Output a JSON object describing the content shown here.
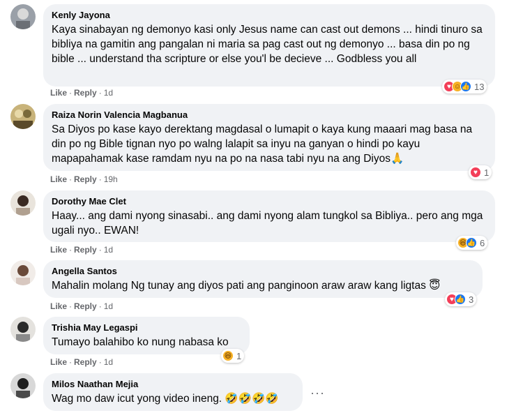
{
  "comments": [
    {
      "author": "Kenly Jayona",
      "text": "Kaya sinabayan ng demonyo kasi only Jesus name can cast out demons ... hindi tinuro sa bibliya na gamitin ang pangalan ni maria sa pag cast out ng demonyo ... basa din po ng bible ... understand tha scripture or else you'l be decieve ... Godbless you all",
      "like": "Like",
      "reply": "Reply",
      "time": "1d",
      "reaction_count": "13",
      "reactions": [
        "heart-icon",
        "care-icon",
        "like-icon"
      ]
    },
    {
      "author": "Raiza Norin Valencia Magbanua",
      "text": "Sa Diyos po kase kayo derektang magdasal o lumapit o kaya kung maaari mag basa na din po ng Bible tignan nyo po walng lalapit sa inyu na ganyan o hindi po kayu mapapahamak kase ramdam nyu na po na nasa tabi nyu na ang Diyos🙏",
      "like": "Like",
      "reply": "Reply",
      "time": "19h",
      "reaction_count": "1",
      "reactions": [
        "heart-icon"
      ]
    },
    {
      "author": "Dorothy Mae Clet",
      "text": "Haay... ang dami nyong sinasabi.. ang dami nyong alam tungkol sa Bibliya.. pero ang mga ugali nyo.. EWAN!",
      "like": "Like",
      "reply": "Reply",
      "time": "1d",
      "reaction_count": "6",
      "reactions": [
        "haha-icon",
        "like-icon"
      ]
    },
    {
      "author": "Angella Santos",
      "text": "Mahalin molang Ng tunay ang diyos pati ang panginoon araw araw kang ligtas 😇",
      "like": "Like",
      "reply": "Reply",
      "time": "1d",
      "reaction_count": "3",
      "reactions": [
        "heart-icon",
        "like-icon"
      ]
    },
    {
      "author": "Trishia May Legaspi",
      "text": "Tumayo balahibo ko nung nabasa ko",
      "like": "Like",
      "reply": "Reply",
      "time": "1d",
      "reaction_count": "1",
      "reactions": [
        "haha-icon"
      ]
    },
    {
      "author": "Milos Naathan Mejia",
      "text": "Wag mo daw icut yong video ineng. 🤣🤣🤣🤣",
      "more": "···"
    }
  ],
  "colors": {
    "bubble": "#f0f2f5",
    "meta": "#65676b",
    "heart": "#f33e58",
    "like": "#1877f2",
    "haha": "#f7b125"
  }
}
